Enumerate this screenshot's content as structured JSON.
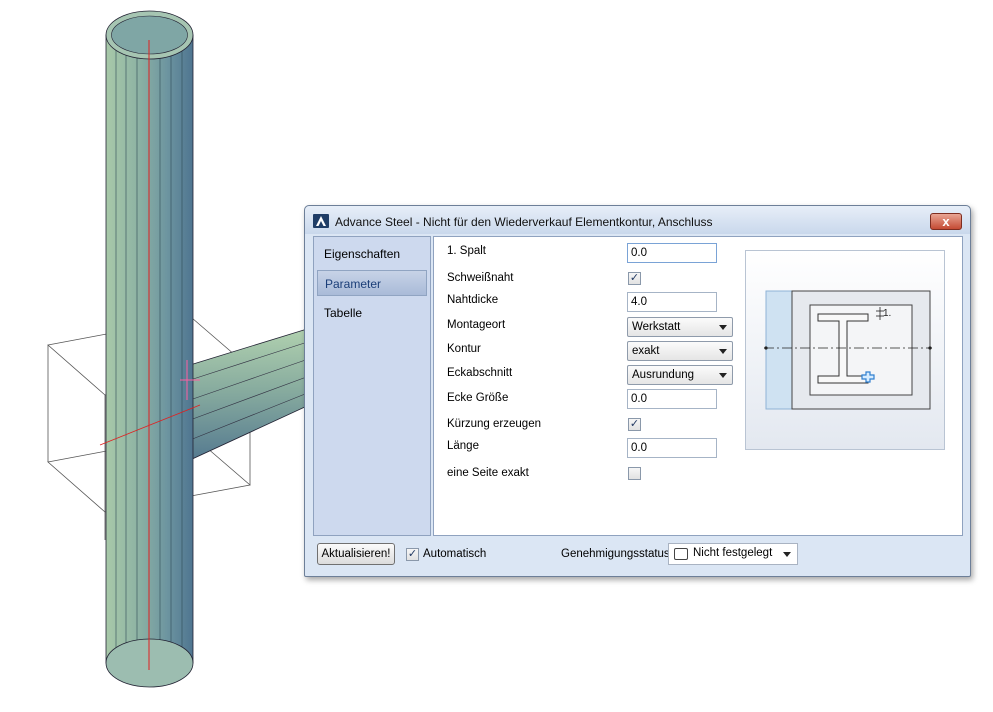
{
  "dialog": {
    "title": "Advance Steel - Nicht für den Wiederverkauf   Elementkontur, Anschluss",
    "close_label": "x"
  },
  "nav": {
    "items": [
      {
        "label": "Eigenschaften",
        "active": false
      },
      {
        "label": "Parameter",
        "active": true
      },
      {
        "label": "Tabelle",
        "active": false
      }
    ]
  },
  "params": {
    "spalt": {
      "label": "1. Spalt",
      "value": "0.0"
    },
    "schweissnaht": {
      "label": "Schweißnaht",
      "checked": true
    },
    "nahtdicke": {
      "label": "Nahtdicke",
      "value": "4.0"
    },
    "montageort": {
      "label": "Montageort",
      "value": "Werkstatt"
    },
    "kontur": {
      "label": "Kontur",
      "value": "exakt"
    },
    "eckabschnitt": {
      "label": "Eckabschnitt",
      "value": "Ausrundung"
    },
    "ecke_groesse": {
      "label": "Ecke Größe",
      "value": "0.0"
    },
    "kuerzung": {
      "label": "Kürzung erzeugen",
      "checked": true
    },
    "laenge": {
      "label": "Länge",
      "value": "0.0"
    },
    "seite_exakt": {
      "label": "eine Seite exakt",
      "checked": false
    }
  },
  "preview": {
    "dimension_label": "1."
  },
  "footer": {
    "update_button": "Aktualisieren!",
    "auto_label": "Automatisch",
    "auto_checked": true,
    "status_label": "Genehmigungsstatus",
    "status_value": "Nicht festgelegt"
  },
  "icons": {
    "checkmark": "✓",
    "app": "advance-steel-logo"
  },
  "colors": {
    "tube_fill": "#8fb3a8",
    "axis_line": "#e02020",
    "dialog_bg": "#dbe6f4",
    "nav_active": "#a9bbd8"
  }
}
